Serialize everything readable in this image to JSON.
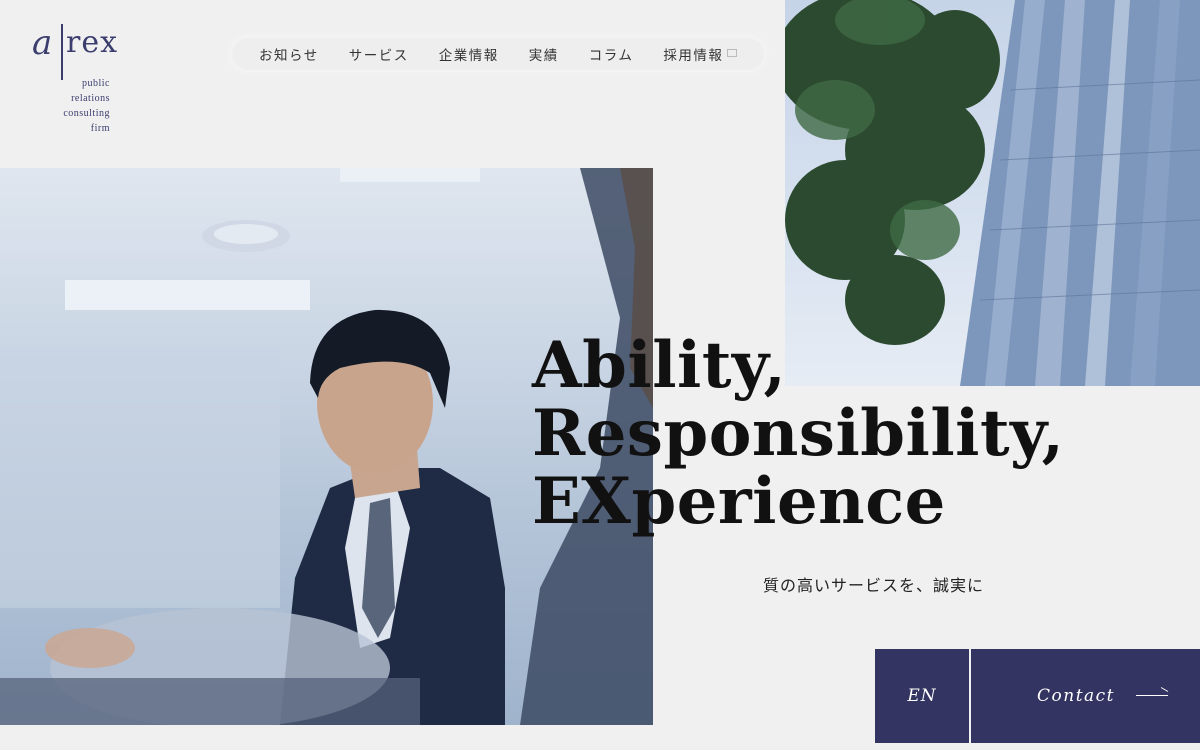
{
  "brand": {
    "logo_a": "a",
    "logo_rex": "rex",
    "tagline_lines": [
      "public",
      "relations",
      "consulting",
      "firm"
    ]
  },
  "nav": {
    "items": [
      {
        "label": "お知らせ"
      },
      {
        "label": "サービス"
      },
      {
        "label": "企業情報"
      },
      {
        "label": "実績"
      },
      {
        "label": "コラム"
      },
      {
        "label": "採用情報"
      }
    ]
  },
  "hero": {
    "lines": [
      "Ability,",
      "Responsibility,",
      "EXperience"
    ],
    "subtitle": "質の高いサービスを、誠実に"
  },
  "buttons": {
    "en_label": "EN",
    "contact_label": "Contact"
  },
  "colors": {
    "brand_navy": "#343463",
    "logo_navy": "#3b3d6e",
    "background": "#f0f0f0"
  },
  "icons": {
    "external_link": "external-link-icon",
    "contact_arrow": "arrow-right-icon"
  }
}
